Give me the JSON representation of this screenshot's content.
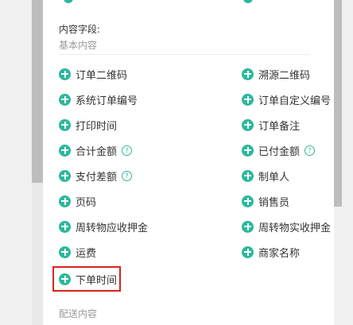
{
  "section": {
    "title": "内容字段:",
    "subtitle": "基本内容",
    "next_subtitle": "配送内容"
  },
  "fields": [
    {
      "id": "order-qr",
      "label": "订单二维码",
      "help": false
    },
    {
      "id": "trace-qr",
      "label": "溯源二维码",
      "help": false
    },
    {
      "id": "system-order-no",
      "label": "系统订单编号",
      "help": false
    },
    {
      "id": "custom-order-no",
      "label": "订单自定义编号",
      "help": false
    },
    {
      "id": "print-time",
      "label": "打印时间",
      "help": false
    },
    {
      "id": "order-remark",
      "label": "订单备注",
      "help": false
    },
    {
      "id": "total-amount",
      "label": "合计金额",
      "help": true
    },
    {
      "id": "paid-amount",
      "label": "已付金额",
      "help": true
    },
    {
      "id": "payment-diff",
      "label": "支付差额",
      "help": true
    },
    {
      "id": "creator",
      "label": "制单人",
      "help": false
    },
    {
      "id": "page-number",
      "label": "页码",
      "help": false
    },
    {
      "id": "salesperson",
      "label": "销售员",
      "help": false
    },
    {
      "id": "deposit-receivable",
      "label": "周转物应收押金",
      "help": false
    },
    {
      "id": "deposit-received",
      "label": "周转物实收押金",
      "help": false
    },
    {
      "id": "freight",
      "label": "运费",
      "help": false
    },
    {
      "id": "merchant-name",
      "label": "商家名称",
      "help": false
    },
    {
      "id": "order-time",
      "label": "下单时间",
      "help": false
    }
  ],
  "help_glyph": "?",
  "colors": {
    "accent": "#2cb89b",
    "highlight": "#d9231c"
  }
}
